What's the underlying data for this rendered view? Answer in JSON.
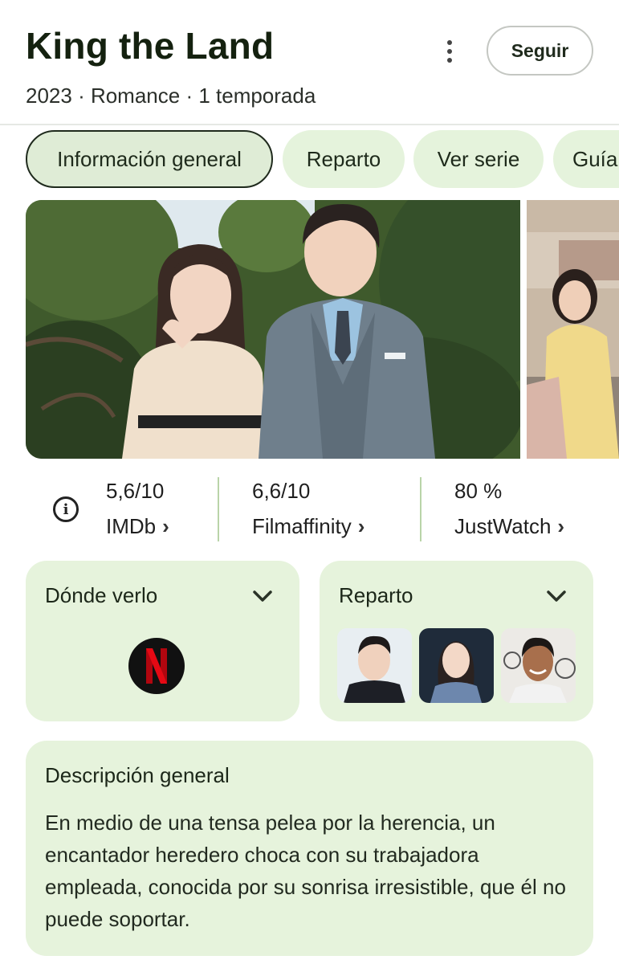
{
  "header": {
    "title": "King the Land",
    "subtitle": "2023 · Romance · 1 temporada",
    "follow_label": "Seguir",
    "more_icon": "more-vert-icon"
  },
  "tabs": [
    {
      "label": "Información general",
      "active": true
    },
    {
      "label": "Reparto",
      "active": false
    },
    {
      "label": "Ver serie",
      "active": false
    },
    {
      "label": "Guía",
      "active": false
    }
  ],
  "ratings": [
    {
      "score": "5,6/10",
      "source": "IMDb"
    },
    {
      "score": "6,6/10",
      "source": "Filmaffinity"
    },
    {
      "score": "80 %",
      "source": "JustWatch"
    }
  ],
  "where_to_watch": {
    "title": "Dónde verlo",
    "provider_logo": "N"
  },
  "cast": {
    "title": "Reparto"
  },
  "description": {
    "title": "Descripción general",
    "text": "En medio de una tensa pelea por la herencia, un encantador heredero choca con su trabajadora empleada, conocida por su sonrisa irresistible, que él no puede soportar."
  },
  "colors": {
    "card_bg": "#e6f3dc",
    "tab_bg": "#e5f3dc",
    "netflix_red": "#e50914"
  }
}
